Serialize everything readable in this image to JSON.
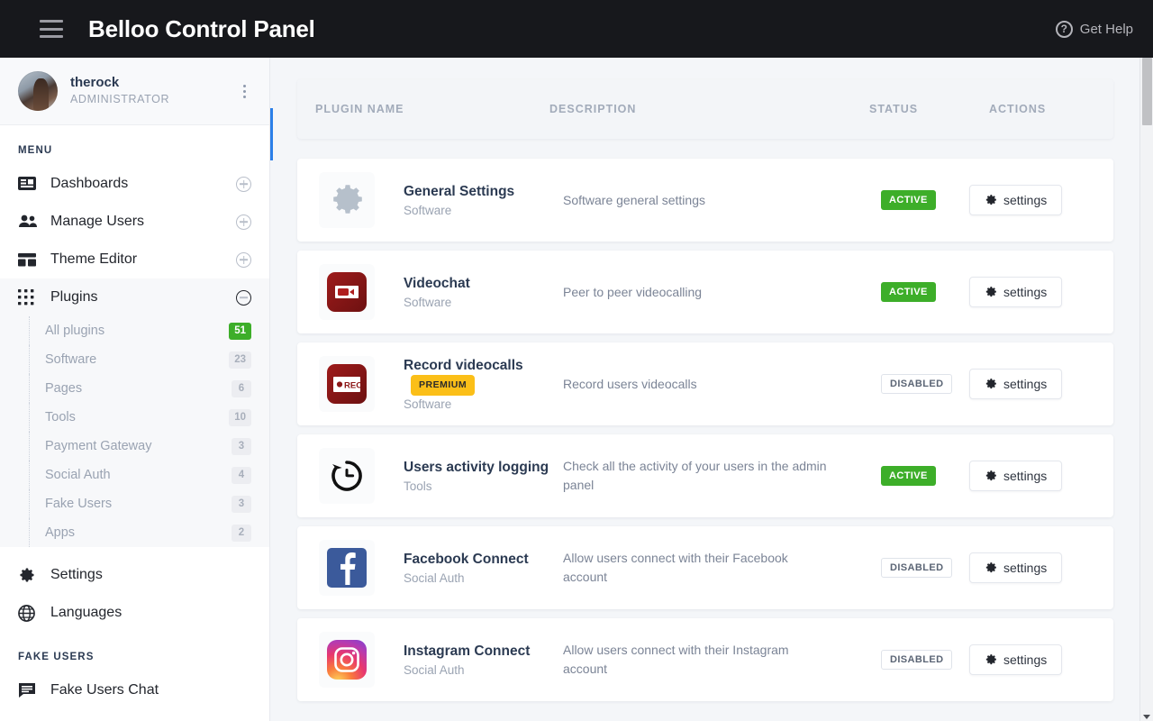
{
  "topbar": {
    "menu_icon": "hamburger-icon",
    "title": "Belloo Control Panel",
    "help_label": "Get Help",
    "help_icon": "question-circle-icon"
  },
  "sidebar": {
    "profile": {
      "name": "therock",
      "role": "ADMINISTRATOR",
      "menu_icon": "kebab-menu-icon"
    },
    "menu_label": "MENU",
    "items": [
      {
        "label": "Dashboards",
        "icon": "dashboard-icon",
        "expander": "plus"
      },
      {
        "label": "Manage Users",
        "icon": "users-icon",
        "expander": "plus"
      },
      {
        "label": "Theme Editor",
        "icon": "layout-icon",
        "expander": "plus"
      },
      {
        "label": "Plugins",
        "icon": "grid-apps-icon",
        "expander": "minus"
      }
    ],
    "submenu": [
      {
        "label": "All plugins",
        "count": "51",
        "highlight": true
      },
      {
        "label": "Software",
        "count": "23",
        "highlight": false
      },
      {
        "label": "Pages",
        "count": "6",
        "highlight": false
      },
      {
        "label": "Tools",
        "count": "10",
        "highlight": false
      },
      {
        "label": "Payment Gateway",
        "count": "3",
        "highlight": false
      },
      {
        "label": "Social Auth",
        "count": "4",
        "highlight": false
      },
      {
        "label": "Fake Users",
        "count": "3",
        "highlight": false
      },
      {
        "label": "Apps",
        "count": "2",
        "highlight": false
      }
    ],
    "bottom_items": [
      {
        "label": "Settings",
        "icon": "gear-icon"
      },
      {
        "label": "Languages",
        "icon": "globe-icon"
      }
    ],
    "fake_users_label": "FAKE USERS",
    "fake_users_items": [
      {
        "label": "Fake Users Chat",
        "icon": "chat-icon"
      }
    ]
  },
  "table": {
    "headers": {
      "name": "PLUGIN NAME",
      "description": "DESCRIPTION",
      "status": "STATUS",
      "actions": "ACTIONS"
    },
    "settings_label": "settings",
    "settings_icon": "gear-icon",
    "rows": [
      {
        "name": "General Settings",
        "category": "Software",
        "description": "Software general settings",
        "status": "ACTIVE",
        "premium": "",
        "icon": "gear-plugin-icon"
      },
      {
        "name": "Videochat",
        "category": "Software",
        "description": "Peer to peer videocalling",
        "status": "ACTIVE",
        "premium": "",
        "icon": "videocamera-plugin-icon"
      },
      {
        "name": "Record videocalls",
        "category": "Software",
        "description": "Record users videocalls",
        "status": "DISABLED",
        "premium": "PREMIUM",
        "icon": "record-plugin-icon"
      },
      {
        "name": "Users activity logging",
        "category": "Tools",
        "description": "Check all the activity of your users in the admin panel",
        "status": "ACTIVE",
        "premium": "",
        "icon": "clock-history-plugin-icon"
      },
      {
        "name": "Facebook Connect",
        "category": "Social Auth",
        "description": "Allow users connect with their Facebook account",
        "status": "DISABLED",
        "premium": "",
        "icon": "facebook-plugin-icon"
      },
      {
        "name": "Instagram Connect",
        "category": "Social Auth",
        "description": "Allow users connect with their Instagram account",
        "status": "DISABLED",
        "premium": "",
        "icon": "instagram-plugin-icon"
      }
    ]
  },
  "colors": {
    "topbar": "#17181c",
    "active_green": "#3dae29",
    "premium_gold": "#fbbf18",
    "accent_blue": "#2b7fe8",
    "heading_navy": "#2b3a52"
  }
}
